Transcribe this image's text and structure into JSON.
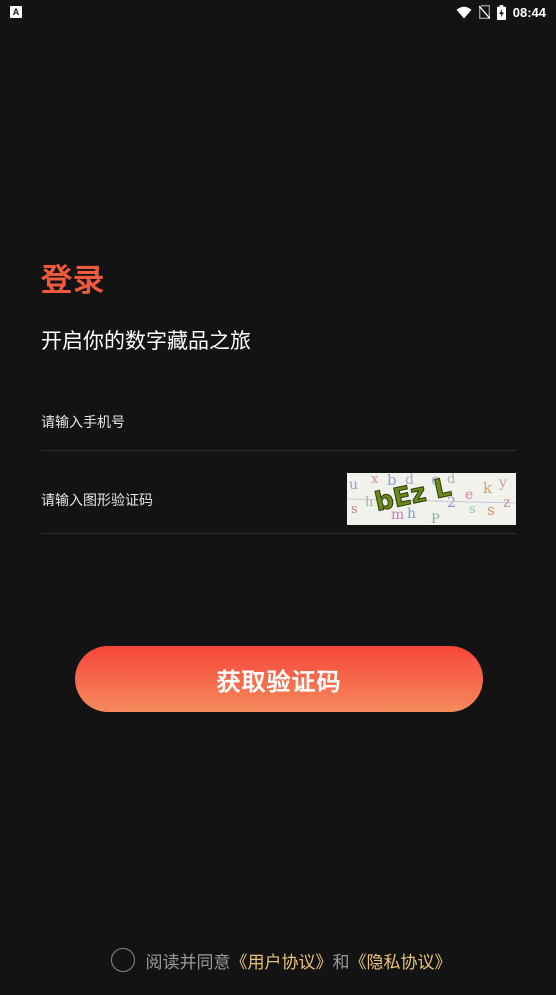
{
  "status_bar": {
    "notification_glyph": "A",
    "time": "08:44"
  },
  "login": {
    "title": "登录",
    "subtitle": "开启你的数字藏品之旅",
    "phone_placeholder": "请输入手机号",
    "captcha_placeholder": "请输入图形验证码",
    "captcha_text": "bEz L",
    "submit_label": "获取验证码"
  },
  "agreement": {
    "prefix": "阅读并同意",
    "user_agreement": "《用户协议》",
    "conjunction": "和",
    "privacy_policy": "《隐私协议》"
  },
  "colors": {
    "background": "#131313",
    "title": "#f05a3c",
    "button_top": "#f7463a",
    "button_bottom": "#f58a5c",
    "link": "#e9c37a",
    "muted_text": "#9a9a9a"
  }
}
